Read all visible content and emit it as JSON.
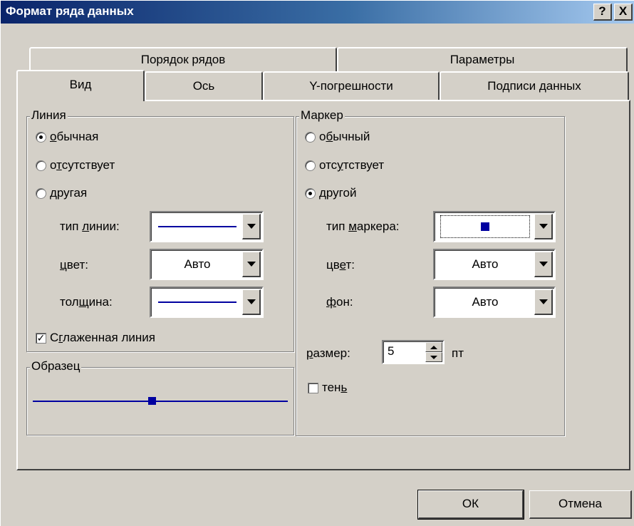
{
  "window": {
    "title": "Формат ряда данных",
    "help_button": "?",
    "close_button": "X"
  },
  "tabs": {
    "top_row": [
      "Порядок рядов",
      "Параметры"
    ],
    "bottom_row": [
      "Вид",
      "Ось",
      "Y-погрешности",
      "Подписи данных"
    ],
    "active": "Вид"
  },
  "line_group": {
    "legend": "Линия",
    "options": [
      {
        "pre": "",
        "acc": "о",
        "post": "бычная",
        "selected": true
      },
      {
        "pre": "о",
        "acc": "т",
        "post": "сутствует",
        "selected": false
      },
      {
        "pre": "",
        "acc": "",
        "post": "другая",
        "selected": false
      }
    ],
    "type_label": {
      "pre": "тип ",
      "acc": "л",
      "post": "инии:"
    },
    "color_label": {
      "pre": "",
      "acc": "ц",
      "post": "вет:"
    },
    "color_value": "Авто",
    "weight_label": {
      "pre": "тол",
      "acc": "щ",
      "post": "ина:"
    },
    "smoothed": {
      "pre": "С",
      "acc": "г",
      "post": "лаженная линия",
      "checked": true
    }
  },
  "sample_group": {
    "legend": "Образец"
  },
  "marker_group": {
    "legend": "Маркер",
    "options": [
      {
        "pre": "о",
        "acc": "б",
        "post": "ычный",
        "selected": false
      },
      {
        "pre": "отс",
        "acc": "у",
        "post": "тствует",
        "selected": false
      },
      {
        "pre": "",
        "acc": "",
        "post": "другой",
        "selected": true
      }
    ],
    "type_label": {
      "pre": "тип ",
      "acc": "м",
      "post": "аркера:"
    },
    "color_label": {
      "pre": "цв",
      "acc": "е",
      "post": "т:"
    },
    "color_value": "Авто",
    "bg_label": {
      "pre": "",
      "acc": "ф",
      "post": "он:"
    },
    "bg_value": "Авто",
    "size_label": {
      "pre": "",
      "acc": "р",
      "post": "азмер:"
    },
    "size_value": "5",
    "size_unit": "пт",
    "shadow": {
      "pre": "тен",
      "acc": "ь",
      "post": "",
      "checked": false
    }
  },
  "buttons": {
    "ok": "ОК",
    "cancel": "Отмена"
  },
  "colors": {
    "titlebar_start": "#0a246a",
    "titlebar_end": "#a6caf0",
    "face": "#d4d0c8",
    "line_color": "#0000a0"
  }
}
